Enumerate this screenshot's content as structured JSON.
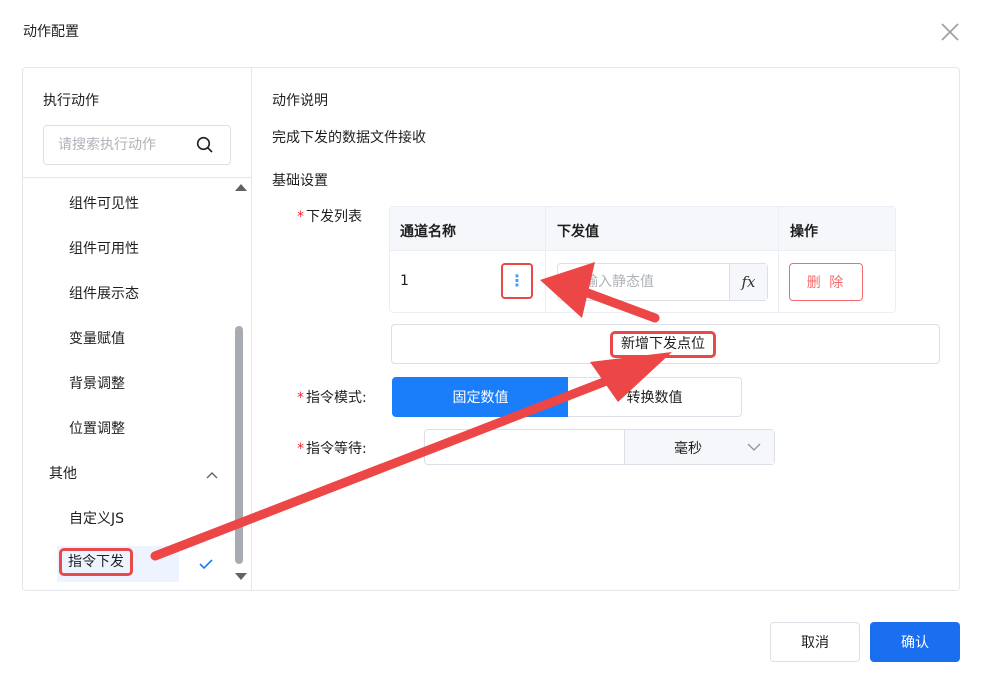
{
  "dialog": {
    "title": "动作配置"
  },
  "left_panel": {
    "title": "执行动作",
    "search_placeholder": "请搜索执行动作",
    "items": [
      "组件可见性",
      "组件可用性",
      "组件展示态",
      "变量赋值",
      "背景调整",
      "位置调整"
    ],
    "group": {
      "label": "其他",
      "items": [
        "自定义JS",
        "指令下发"
      ]
    },
    "selected_item": "指令下发"
  },
  "right_panel": {
    "description_label": "动作说明",
    "description_text": "完成下发的数据文件接收",
    "section_title": "基础设置",
    "dispatch_list": {
      "required_mark": "*",
      "label": "下发列表",
      "columns": [
        "通道名称",
        "下发值",
        "操作"
      ],
      "rows": [
        {
          "channel": "1",
          "more": "⋮",
          "value_placeholder": "请输入静态值",
          "fx": "fx",
          "delete_label": "删 除"
        }
      ],
      "add_button": "新增下发点位"
    },
    "command_mode": {
      "required_mark": "*",
      "label": "指令模式:",
      "options": [
        "固定数值",
        "转换数值"
      ],
      "selected": "固定数值"
    },
    "command_wait": {
      "required_mark": "*",
      "label": "指令等待:",
      "value": "",
      "unit": "毫秒"
    }
  },
  "footer": {
    "cancel": "取消",
    "confirm": "确认"
  },
  "colors": {
    "primary": "#1a7dfa",
    "danger": "#f56c6c",
    "annotation": "#e84a4a"
  }
}
